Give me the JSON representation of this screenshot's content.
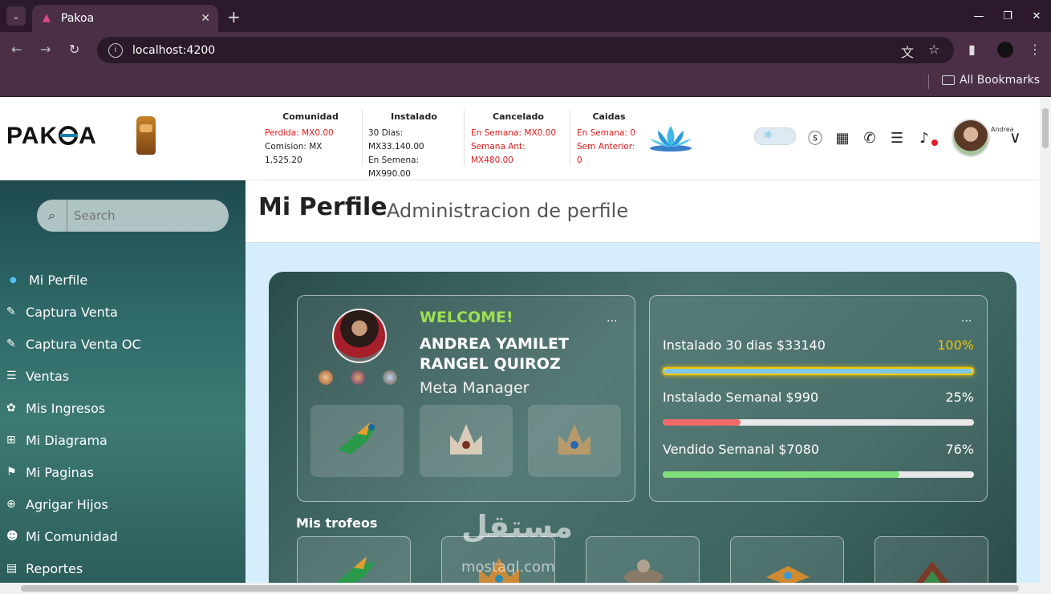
{
  "browser": {
    "tab_title": "Pakoa",
    "url": "localhost:4200",
    "bookmarks_label": "All Bookmarks"
  },
  "header": {
    "logo": "PAKOA",
    "stats": [
      {
        "title": "Comunidad",
        "lines": [
          {
            "text": "Perdida: MX0.00",
            "red": true
          },
          {
            "text": "Comision: MX 1,525.20",
            "red": false
          }
        ]
      },
      {
        "title": "Instalado",
        "lines": [
          {
            "text": "30 Dias: MX33.140.00",
            "red": false
          },
          {
            "text": "En Semena: MX990.00",
            "red": false
          }
        ]
      },
      {
        "title": "Cancelado",
        "lines": [
          {
            "text": "En Semana: MX0.00",
            "red": true
          },
          {
            "text": "Semana Ant: MX480.00",
            "red": true
          }
        ]
      },
      {
        "title": "Caidas",
        "lines": [
          {
            "text": "En Semana: 0",
            "red": true
          },
          {
            "text": "Sem Anterior: 0",
            "red": true
          }
        ]
      }
    ],
    "user_name": "Andrea"
  },
  "sidebar": {
    "search_placeholder": "Search",
    "items": [
      {
        "label": "Mi Perfile",
        "icon": "user-icon"
      },
      {
        "label": "Captura Venta",
        "icon": "edit-icon"
      },
      {
        "label": "Captura Venta OC",
        "icon": "edit-icon"
      },
      {
        "label": "Ventas",
        "icon": "list-icon"
      },
      {
        "label": "Mis Ingresos",
        "icon": "money-icon"
      },
      {
        "label": "Mi Diagrama",
        "icon": "diagram-icon"
      },
      {
        "label": "Mi Paginas",
        "icon": "flag-icon"
      },
      {
        "label": "Agrigar Hijos",
        "icon": "add-user-icon"
      },
      {
        "label": "Mi Comunidad",
        "icon": "users-icon"
      },
      {
        "label": "Reportes",
        "icon": "report-icon"
      }
    ]
  },
  "page": {
    "title": "Mi Perfile",
    "subtitle": "Administracion de perfile"
  },
  "profile": {
    "welcome": "WELCOME!",
    "name": "ANDREA YAMILET RANGEL QUIROZ",
    "role": "Meta Manager",
    "menu": "..."
  },
  "progress": {
    "menu": "...",
    "rows": [
      {
        "label": "Instalado 30 dias $33140",
        "pct": "100%",
        "value": 1.0,
        "color": "#f2c500",
        "fill": "#7ec8e3"
      },
      {
        "label": "Instalado Semanal $990",
        "pct": "25%",
        "value": 0.25,
        "color": "#ffffff",
        "fill": "#f06a6a"
      },
      {
        "label": "Vendido Semanal $7080",
        "pct": "76%",
        "value": 0.76,
        "color": "#ffffff",
        "fill": "#7fe07a"
      }
    ]
  },
  "trophies_title": "Mis trofeos",
  "watermark": {
    "ar": "مستقل",
    "latin": "mostaql.com"
  }
}
